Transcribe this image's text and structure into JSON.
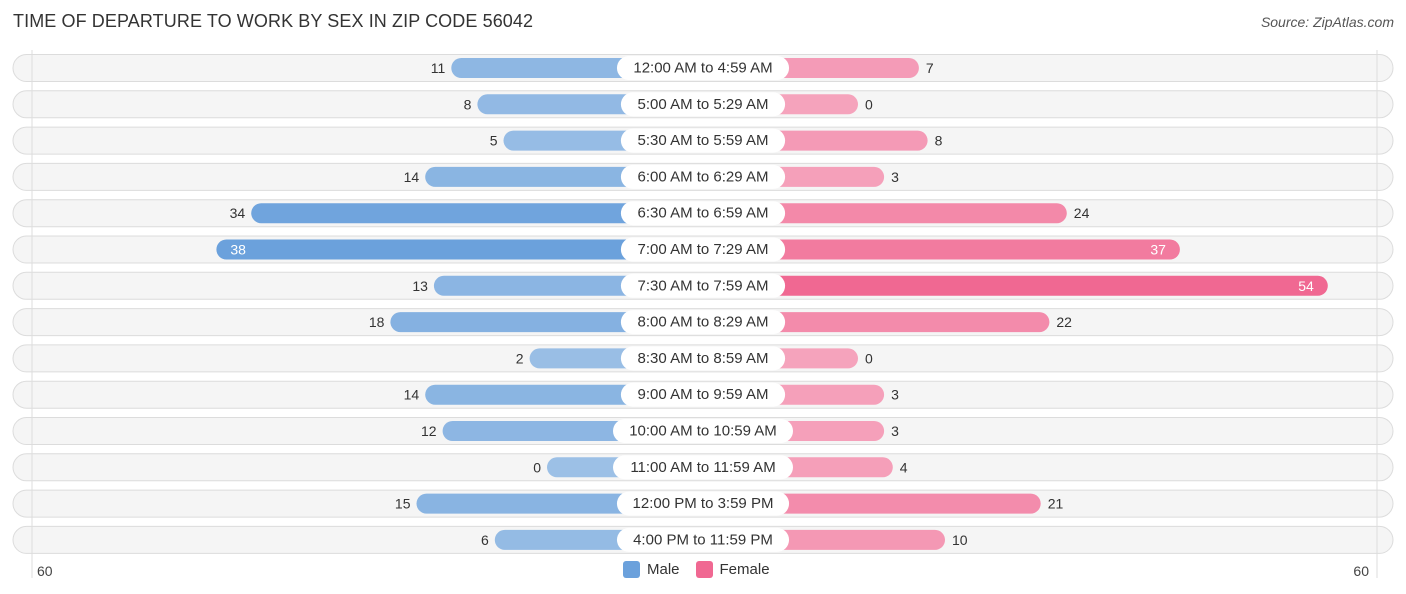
{
  "header": {
    "title": "TIME OF DEPARTURE TO WORK BY SEX IN ZIP CODE 56042",
    "source": "Source: ZipAtlas.com"
  },
  "colors": {
    "male": "#6ba1dc",
    "male_light": "#9cc0e6",
    "female": "#f06892",
    "female_light": "#f5a3bc"
  },
  "chart_data": {
    "type": "bar",
    "orientation": "horizontal-diverging",
    "title": "TIME OF DEPARTURE TO WORK BY SEX IN ZIP CODE 56042",
    "categories": [
      "12:00 AM to 4:59 AM",
      "5:00 AM to 5:29 AM",
      "5:30 AM to 5:59 AM",
      "6:00 AM to 6:29 AM",
      "6:30 AM to 6:59 AM",
      "7:00 AM to 7:29 AM",
      "7:30 AM to 7:59 AM",
      "8:00 AM to 8:29 AM",
      "8:30 AM to 8:59 AM",
      "9:00 AM to 9:59 AM",
      "10:00 AM to 10:59 AM",
      "11:00 AM to 11:59 AM",
      "12:00 PM to 3:59 PM",
      "4:00 PM to 11:59 PM"
    ],
    "series": [
      {
        "name": "Male",
        "side": "left",
        "values": [
          11,
          8,
          5,
          14,
          34,
          38,
          13,
          18,
          2,
          14,
          12,
          0,
          15,
          6
        ]
      },
      {
        "name": "Female",
        "side": "right",
        "values": [
          7,
          0,
          8,
          3,
          24,
          37,
          54,
          22,
          0,
          3,
          3,
          4,
          21,
          10
        ]
      }
    ],
    "axis": {
      "left_max_label": "60",
      "right_max_label": "60",
      "max": 60
    },
    "legend": {
      "entries": [
        "Male",
        "Female"
      ],
      "position": "bottom-center"
    },
    "grid": false
  }
}
